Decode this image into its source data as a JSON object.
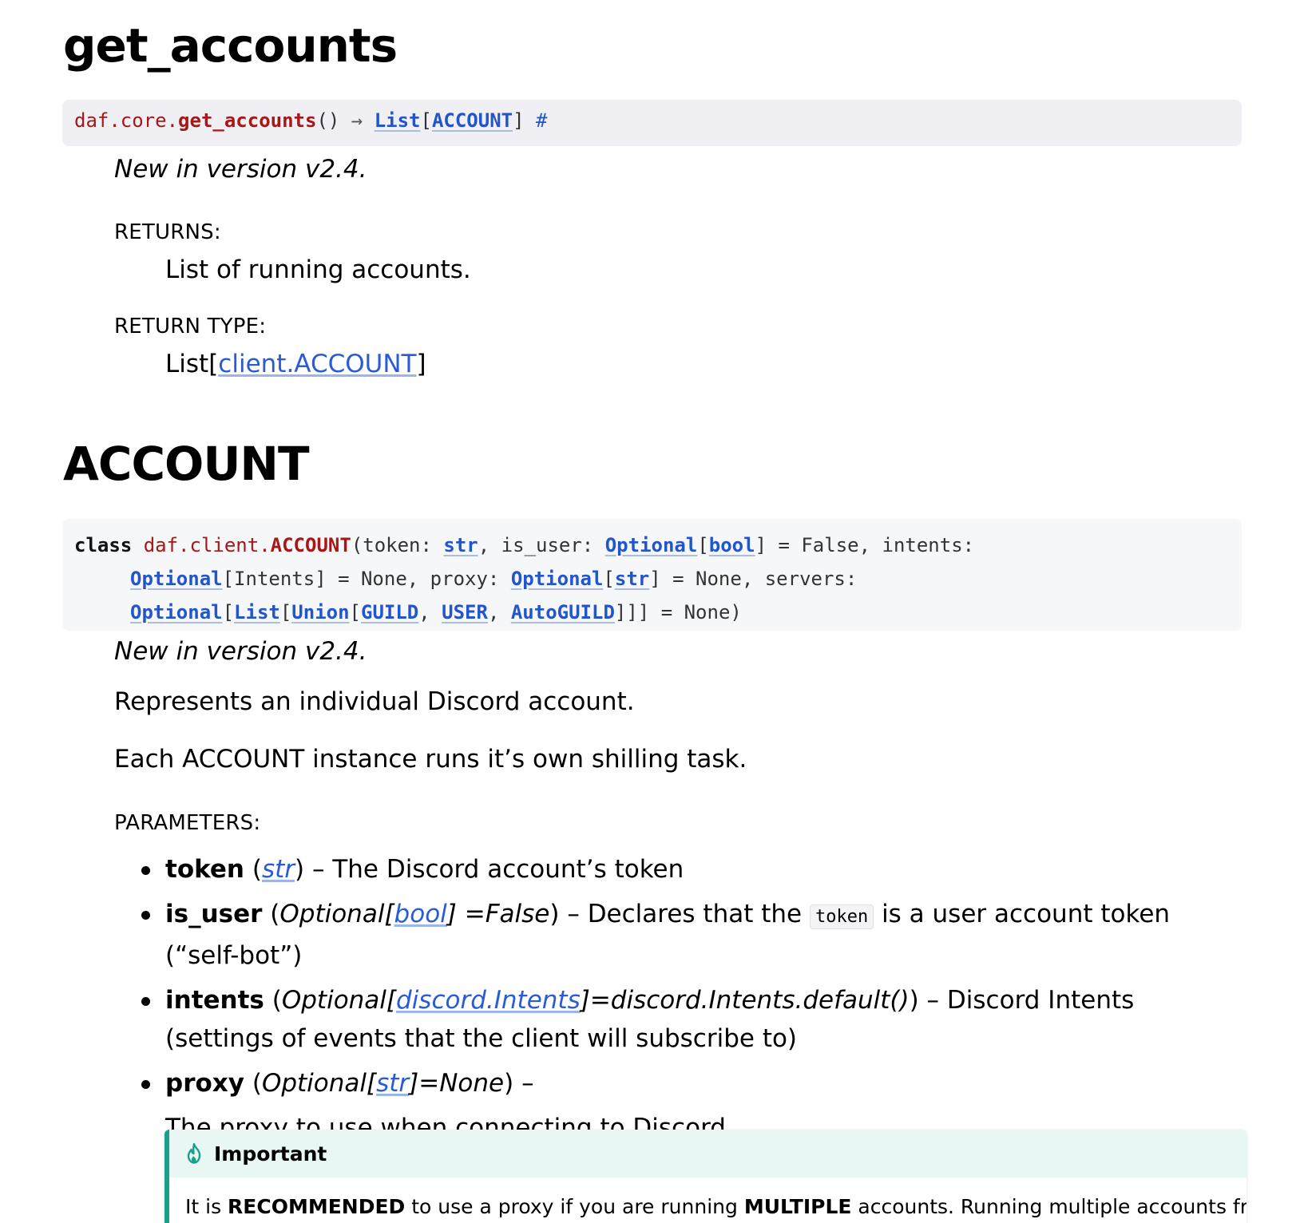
{
  "section1": {
    "title": "get_accounts",
    "signature": {
      "prefix": "daf.core.",
      "name": "get_accounts",
      "parens": "()",
      "arrow": "→",
      "ret_list": "List",
      "ret_open": "[",
      "ret_type": "ACCOUNT",
      "ret_close": "]",
      "anchor": "#"
    },
    "version_note": "New in version v2.4.",
    "returns_label": "Returns:",
    "returns_text": "List of running accounts.",
    "return_type_label": "Return type:",
    "return_type_prefix": "List[",
    "return_type_link": "client.ACCOUNT",
    "return_type_suffix": "]"
  },
  "section2": {
    "title": "ACCOUNT",
    "signature": {
      "keyword": "class",
      "prefix": "daf.client.",
      "name": "ACCOUNT",
      "line1_a": "(token: ",
      "str1": "str",
      "line1_b": ", is_user: ",
      "optional1": "Optional",
      "bool1": "bool",
      "line1_c": "] = False, intents:",
      "optional2": "Optional",
      "line2_a": "[Intents] = None, proxy: ",
      "optional3": "Optional",
      "str2": "str",
      "line2_b": "] = None, servers:",
      "optional4": "Optional",
      "list1": "List",
      "union1": "Union",
      "guild": "GUILD",
      "user": "USER",
      "autoguild": "AutoGUILD",
      "line3_end": "]]] = None)"
    },
    "version_note": "New in version v2.4.",
    "desc1": "Represents an individual Discord account.",
    "desc2": "Each ACCOUNT instance runs it’s own shilling task.",
    "parameters_label": "Parameters:",
    "params": {
      "token": {
        "name": "token",
        "type_link": "str",
        "desc": "The Discord account’s token"
      },
      "is_user": {
        "name": "is_user",
        "type_pre": "Optional[",
        "type_link": "bool",
        "type_post": "] =False",
        "desc_a": "Declares that the",
        "code": "token",
        "desc_b": "is a user account token (“self-bot”)"
      },
      "intents": {
        "name": "intents",
        "type_pre": "Optional[",
        "type_link": "discord.Intents",
        "type_post": "]=discord.Intents.default()",
        "desc": "Discord Intents (settings of events that the client will subscribe to)"
      },
      "proxy": {
        "name": "proxy",
        "type_pre": "Optional[",
        "type_link": "str",
        "type_post": "]=None",
        "desc": "The proxy to use when connecting to Discord."
      }
    },
    "admonition": {
      "title": "Important",
      "text_a": "It is ",
      "bold_a": "RECOMMENDED",
      "text_b": " to use a proxy if you are running ",
      "bold_b": "MULTIPLE",
      "text_c": " accounts. Running multiple accounts from the"
    }
  },
  "colors": {
    "signature_name": "#a61717",
    "link": "#2a5bd7",
    "admonition_accent": "#1aa08a",
    "admonition_header_bg": "#e8f7f4"
  }
}
